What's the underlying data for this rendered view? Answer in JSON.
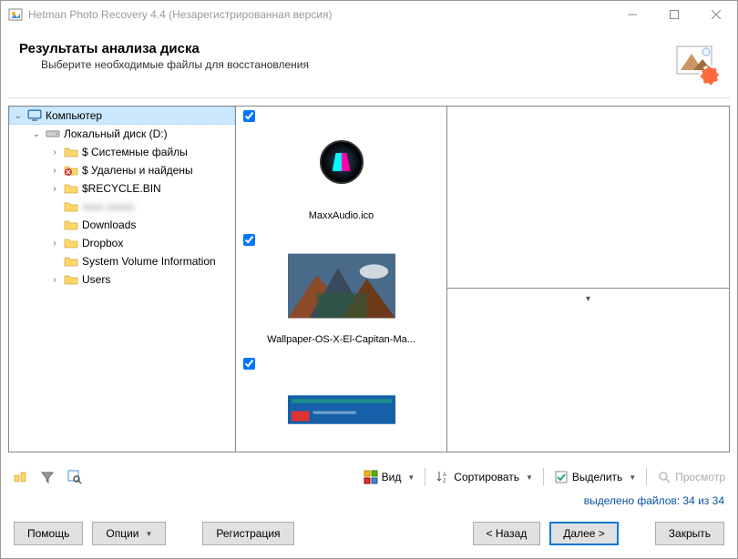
{
  "titlebar": {
    "title": "Hetman Photo Recovery 4.4 (Незарегистрированная версия)"
  },
  "header": {
    "title": "Результаты анализа диска",
    "subtitle": "Выберите необходимые файлы для восстановления"
  },
  "tree": {
    "root": "Компьютер",
    "disk": "Локальный диск (D:)",
    "items": [
      {
        "label": "$ Системные файлы",
        "has_children": true,
        "icon": "folder"
      },
      {
        "label": "$ Удалены и найдены",
        "has_children": true,
        "icon": "deleted"
      },
      {
        "label": "$RECYCLE.BIN",
        "has_children": true,
        "icon": "folder"
      },
      {
        "label": "",
        "has_children": false,
        "icon": "folder",
        "blurred": true
      },
      {
        "label": "Downloads",
        "has_children": false,
        "icon": "folder"
      },
      {
        "label": "Dropbox",
        "has_children": true,
        "icon": "folder"
      },
      {
        "label": "System Volume Information",
        "has_children": false,
        "icon": "folder"
      },
      {
        "label": "Users",
        "has_children": true,
        "icon": "folder"
      }
    ]
  },
  "thumbs": [
    {
      "label": "MaxxAudio.ico",
      "checked": true,
      "kind": "icon"
    },
    {
      "label": "Wallpaper-OS-X-El-Capitan-Ma...",
      "checked": true,
      "kind": "photo"
    },
    {
      "label": "",
      "checked": true,
      "kind": "screenshot"
    }
  ],
  "toolbar": {
    "view": "Вид",
    "sort": "Сортировать",
    "select": "Выделить",
    "preview": "Просмотр"
  },
  "status": "выделено файлов: 34 из 34",
  "buttons": {
    "help": "Помощь",
    "options": "Опции",
    "register": "Регистрация",
    "back": "< Назад",
    "next": "Далее >",
    "close": "Закрыть"
  }
}
